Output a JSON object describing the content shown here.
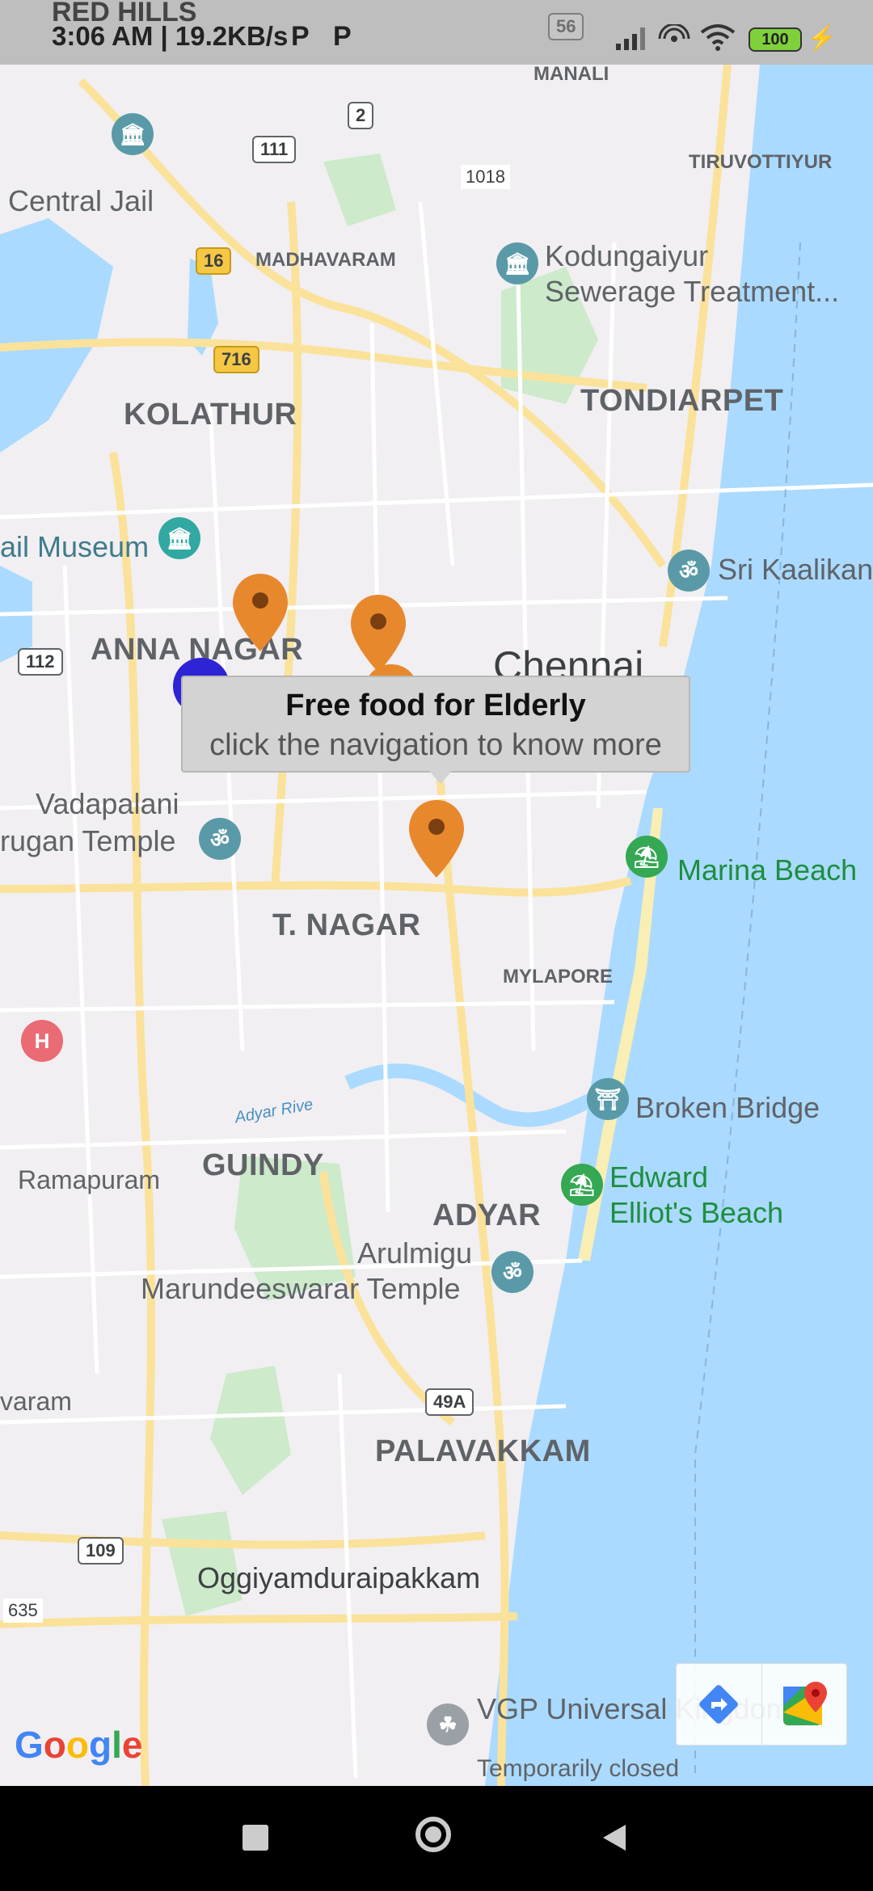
{
  "status_bar": {
    "carrier_overlay": "RED HILLS",
    "time_speed": "3:06 AM | 19.2KB/s",
    "p_icons": [
      "P",
      "P"
    ],
    "battery": "100"
  },
  "map": {
    "area_labels": {
      "kolathur": "KOLATHUR",
      "tondiarpet": "TONDIARPET",
      "anna_nagar": "ANNA NAGAR",
      "t_nagar": "T. NAGAR",
      "guindy": "GUINDY",
      "adyar": "ADYAR",
      "palavakkam": "PALAVAKKAM",
      "madhavaram": "MADHAVARAM",
      "manali": "MANALI",
      "tiruvottiyur": "TIRUVOTTIYUR",
      "mylapore": "MYLAPORE"
    },
    "city_label": "Chennai",
    "poi_labels": {
      "central_jail": "Central Jail",
      "kodungaiyur_1": "Kodungaiyur",
      "kodungaiyur_2": "Sewerage Treatment...",
      "rail_museum": "ail Museum",
      "sri_kaalikan": "Sri Kaalikan",
      "vadapalani_1": "Vadapalani",
      "vadapalani_2": "rugan Temple",
      "marina_beach": "Marina Beach",
      "broken_bridge": "Broken Bridge",
      "edward_1": "Edward",
      "edward_2": "Elliot's Beach",
      "arulmigu_1": "Arulmigu",
      "arulmigu_2": "Marundeeswarar Temple",
      "ramapuram": "Ramapuram",
      "varam": "varam",
      "oggiyam": "Oggiyamduraipakkam",
      "vgp": "VGP Universal Kingdom",
      "temporarily_closed": "Temporarily closed",
      "adyar_river": "Adyar Rive",
      "ellipsis": "..."
    },
    "road_shields": {
      "r56": "56",
      "r2": "2",
      "r111": "111",
      "r16": "16",
      "r716": "716",
      "r112": "112",
      "r49a": "49A",
      "r109": "109",
      "n1018": "1018",
      "n635": "635"
    },
    "info_window": {
      "title": "Free food for Elderly",
      "snippet": "click the navigation to know more"
    },
    "marker_color": "#e8882d",
    "user_marker_color": "#2d24d6",
    "google_logo": "Google"
  }
}
